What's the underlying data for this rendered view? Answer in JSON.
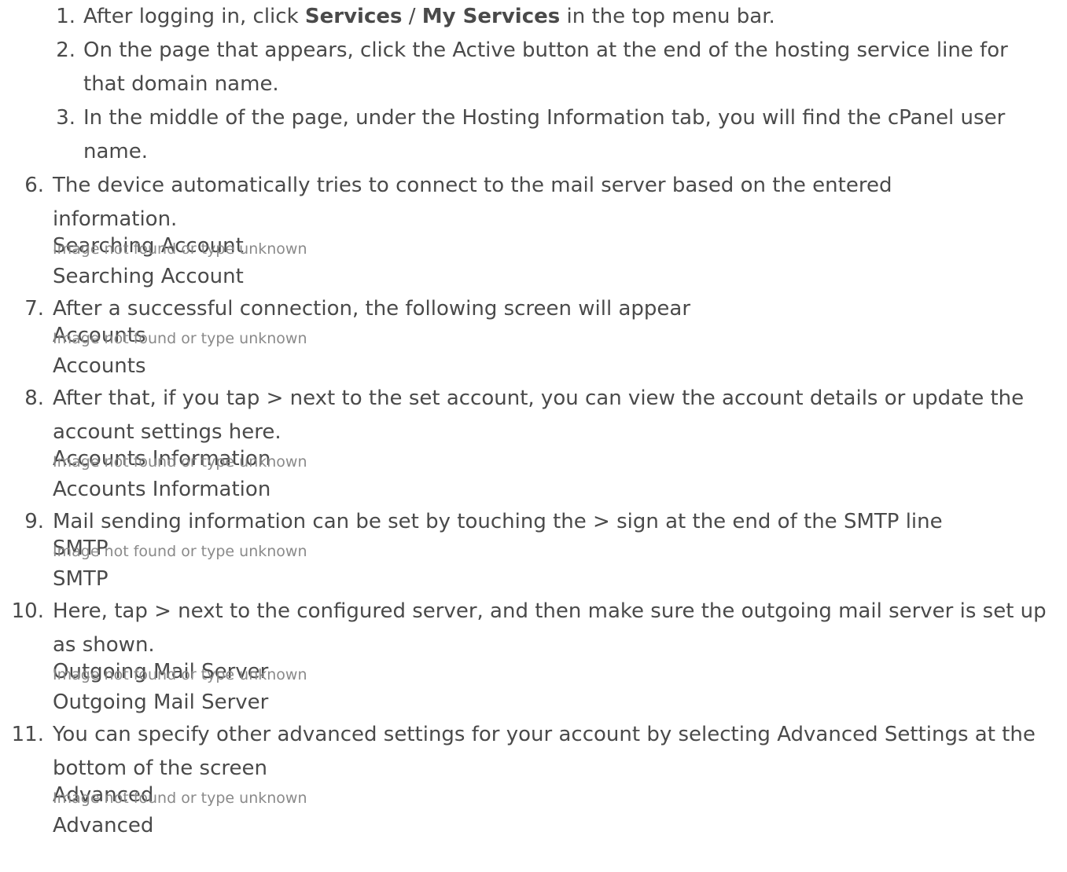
{
  "substeps": [
    {
      "num": "1.",
      "parts": [
        "After logging in, click ",
        "Services",
        " / ",
        "My Services",
        " in the top menu bar."
      ]
    },
    {
      "num": "2.",
      "text": "On the page that appears, click the Active button at the end of the hosting service line for that domain name."
    },
    {
      "num": "3.",
      "text": "In the middle of the page, under the Hosting Information tab, you will find the cPanel user name."
    }
  ],
  "broken_image_text": "Image not found or type unknown",
  "steps": [
    {
      "num": "6.",
      "text": "The device automatically tries to connect to the mail server based on the entered information.",
      "image_alt": "Searching Account",
      "caption": "Searching Account"
    },
    {
      "num": "7.",
      "text": "After a successful connection, the following screen will appear",
      "image_alt": "Accounts",
      "caption": "Accounts"
    },
    {
      "num": "8.",
      "text": "After that, if you tap > next to the set account, you can view the account details or update the account settings here.",
      "image_alt": "Accounts Information",
      "caption": "Accounts Information"
    },
    {
      "num": "9.",
      "text": "Mail sending information can be set by touching the > sign at the end of the SMTP line",
      "image_alt": "SMTP",
      "caption": "SMTP"
    },
    {
      "num": "10.",
      "text": "Here, tap > next to the configured server, and then make sure the outgoing mail server is set up as shown.",
      "image_alt": "Outgoing Mail Server",
      "caption": "Outgoing Mail Server"
    },
    {
      "num": "11.",
      "text": "You can specify other advanced settings for your account by selecting Advanced Settings at the bottom of the screen",
      "image_alt": "Advanced",
      "caption": "Advanced"
    }
  ]
}
